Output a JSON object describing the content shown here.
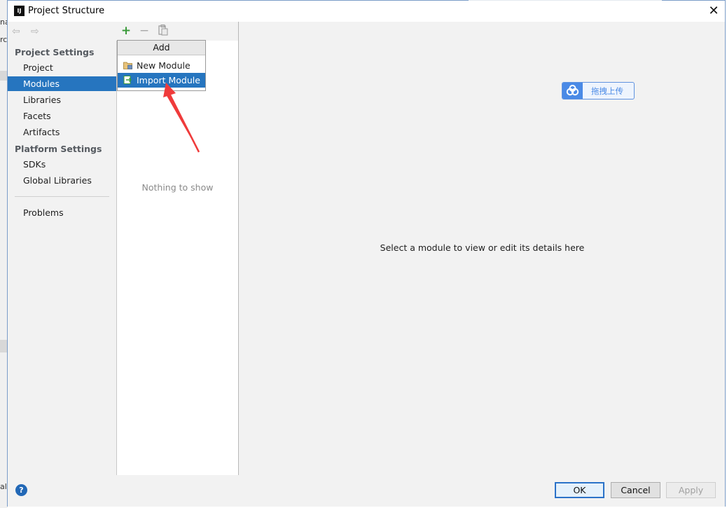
{
  "window": {
    "title": "Project Structure",
    "close_glyph": "✕"
  },
  "background_fragments": [
    "na",
    "rc",
    "al"
  ],
  "sidebar": {
    "back_glyph": "⇦",
    "forward_glyph": "⇨",
    "sections": [
      {
        "title": "Project Settings",
        "items": [
          "Project",
          "Modules",
          "Libraries",
          "Facets",
          "Artifacts"
        ]
      },
      {
        "title": "Platform Settings",
        "items": [
          "SDKs",
          "Global Libraries"
        ]
      }
    ],
    "extra_items": [
      "Problems"
    ],
    "selected": "Modules"
  },
  "module_panel": {
    "toolbar": {
      "add_glyph": "+",
      "remove_glyph": "−",
      "copy_icon": "copy-icon"
    },
    "empty_text": "Nothing to show",
    "popup": {
      "header": "Add",
      "items": [
        {
          "label": "New Module",
          "icon": "folder-icon",
          "selected": false
        },
        {
          "label": "Import Module",
          "icon": "import-icon",
          "selected": true
        }
      ]
    }
  },
  "detail_panel": {
    "hint": "Select a module to view or edit its details here",
    "upload_button": {
      "label": "拖拽上传",
      "icon": "baidu-cloud-icon"
    }
  },
  "footer": {
    "help_glyph": "?",
    "ok": "OK",
    "cancel": "Cancel",
    "apply": "Apply"
  },
  "colors": {
    "selection": "#2675bf",
    "accent_red": "#ef3b3b",
    "add_green": "#3a9a3a",
    "upload_blue": "#4a8ae6"
  }
}
